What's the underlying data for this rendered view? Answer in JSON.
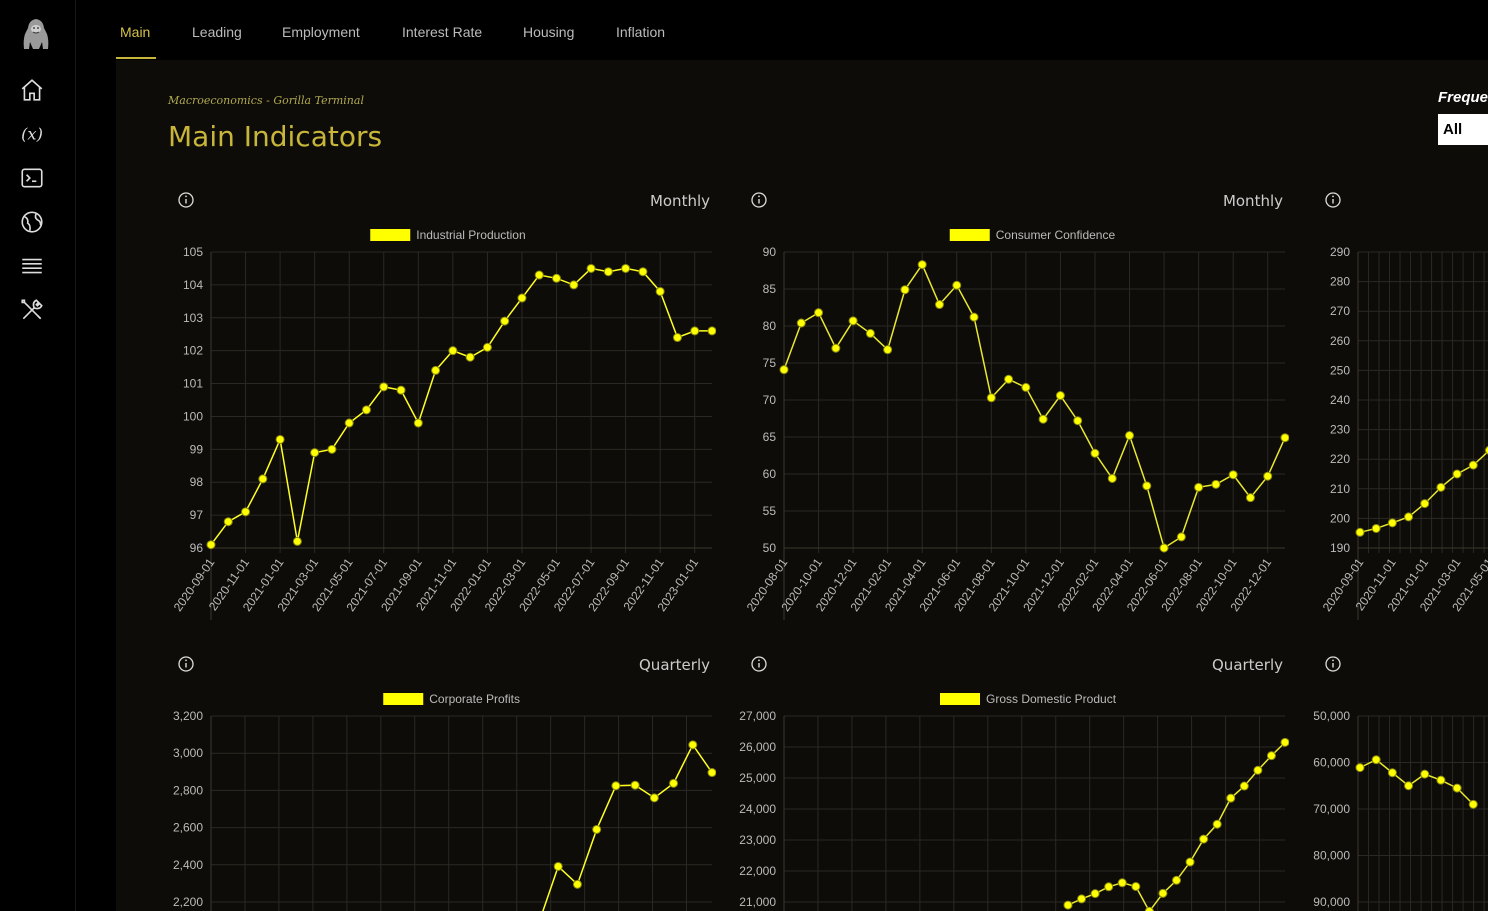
{
  "brand": {
    "logo_icon": "gorilla-logo-icon"
  },
  "sidebar": {
    "items": [
      {
        "name": "home-icon"
      },
      {
        "name": "function-icon"
      },
      {
        "name": "terminal-icon"
      },
      {
        "name": "globe-icon"
      },
      {
        "name": "menu-icon"
      },
      {
        "name": "tools-icon"
      }
    ]
  },
  "nav": {
    "tabs": [
      {
        "label": "Main",
        "active": true
      },
      {
        "label": "Leading"
      },
      {
        "label": "Employment"
      },
      {
        "label": "Interest Rate"
      },
      {
        "label": "Housing"
      },
      {
        "label": "Inflation"
      }
    ]
  },
  "page": {
    "breadcrumb": "Macroeconomics - Gorilla Terminal",
    "title": "Main Indicators",
    "frequency_label": "Frequency",
    "frequency_value": "All"
  },
  "colors": {
    "accent": "#c8b63a",
    "series": "#ffff00"
  },
  "chart_data": [
    {
      "type": "line",
      "frequency": "Monthly",
      "legend": "Industrial Production",
      "ylim": [
        96,
        105
      ],
      "yticks": [
        "105",
        "104",
        "103",
        "102",
        "101",
        "100",
        "99",
        "98",
        "97",
        "96"
      ],
      "xticks": [
        "2020-09-01",
        "2020-11-01",
        "2021-01-01",
        "2021-03-01",
        "2021-05-01",
        "2021-07-01",
        "2021-09-01",
        "2021-11-01",
        "2022-01-01",
        "2022-03-01",
        "2022-05-01",
        "2022-07-01",
        "2022-09-01",
        "2022-11-01",
        "2023-01-01"
      ],
      "values": [
        96.1,
        96.8,
        97.1,
        98.1,
        99.3,
        96.2,
        98.9,
        99.0,
        99.8,
        100.2,
        100.9,
        100.8,
        99.8,
        101.4,
        102.0,
        101.8,
        102.1,
        102.9,
        103.6,
        104.3,
        104.2,
        104.0,
        104.5,
        104.4,
        104.5,
        104.4,
        103.8,
        102.4,
        102.6,
        102.6
      ],
      "grid": true,
      "legend_position": "top"
    },
    {
      "type": "line",
      "frequency": "Monthly",
      "legend": "Consumer Confidence",
      "ylim": [
        50,
        90
      ],
      "yticks": [
        "90",
        "85",
        "80",
        "75",
        "70",
        "65",
        "60",
        "55",
        "50"
      ],
      "xticks": [
        "2020-08-01",
        "2020-10-01",
        "2020-12-01",
        "2021-02-01",
        "2021-04-01",
        "2021-06-01",
        "2021-08-01",
        "2021-10-01",
        "2021-12-01",
        "2022-02-01",
        "2022-04-01",
        "2022-06-01",
        "2022-08-01",
        "2022-10-01",
        "2022-12-01"
      ],
      "values": [
        74.1,
        80.4,
        81.8,
        77.0,
        80.7,
        79.0,
        76.8,
        84.9,
        88.3,
        82.9,
        85.5,
        81.2,
        70.3,
        72.8,
        71.7,
        67.4,
        70.6,
        67.2,
        62.8,
        59.4,
        65.2,
        58.4,
        50.0,
        51.5,
        58.2,
        58.6,
        59.9,
        56.8,
        59.7,
        64.9
      ],
      "grid": true,
      "legend_position": "top"
    },
    {
      "type": "line",
      "frequency": "",
      "legend": "",
      "ylim": [
        190,
        290
      ],
      "yticks": [
        "290",
        "280",
        "270",
        "260",
        "250",
        "240",
        "230",
        "220",
        "210",
        "200",
        "190"
      ],
      "xticks": [
        "2020-09-01",
        "2020-11-01",
        "2021-01-01",
        "2021-03-01",
        "2021-05-01"
      ],
      "values": [
        195.3,
        196.6,
        198.5,
        200.5,
        205.0,
        210.5,
        215.0,
        218.0,
        223.0
      ],
      "grid": true,
      "legend_position": "top"
    },
    {
      "type": "line",
      "frequency": "Quarterly",
      "legend": "Corporate Profits",
      "ylim": [
        2200,
        3200
      ],
      "yticks": [
        "3,200",
        "3,000",
        "2,800",
        "2,600",
        "2,400",
        "2,200"
      ],
      "xticks": [],
      "values": [
        2090,
        2391,
        2295,
        2590,
        2825,
        2828,
        2760,
        2838,
        3045,
        2896
      ],
      "grid": true,
      "legend_position": "top"
    },
    {
      "type": "line",
      "frequency": "Quarterly",
      "legend": "Gross Domestic Product",
      "ylim": [
        21000,
        27000
      ],
      "yticks": [
        "27,000",
        "26,000",
        "25,000",
        "24,000",
        "23,000",
        "22,000",
        "21,000"
      ],
      "xticks": [],
      "values": [
        20900,
        21100,
        21270,
        21490,
        21620,
        21500,
        20700,
        21280,
        21700,
        22290,
        23030,
        23510,
        24350,
        24740,
        25250,
        25720,
        26150
      ],
      "grid": true,
      "legend_position": "top"
    },
    {
      "type": "line",
      "frequency": "",
      "legend": "",
      "ylim": [
        -90000,
        -50000
      ],
      "yticks": [
        "-50,000",
        "-60,000",
        "-70,000",
        "-80,000",
        "-90,000"
      ],
      "xticks": [],
      "values": [
        -61100,
        -59400,
        -62200,
        -65000,
        -62500,
        -63800,
        -65500,
        -69000
      ],
      "grid": true,
      "legend_position": "top"
    }
  ]
}
